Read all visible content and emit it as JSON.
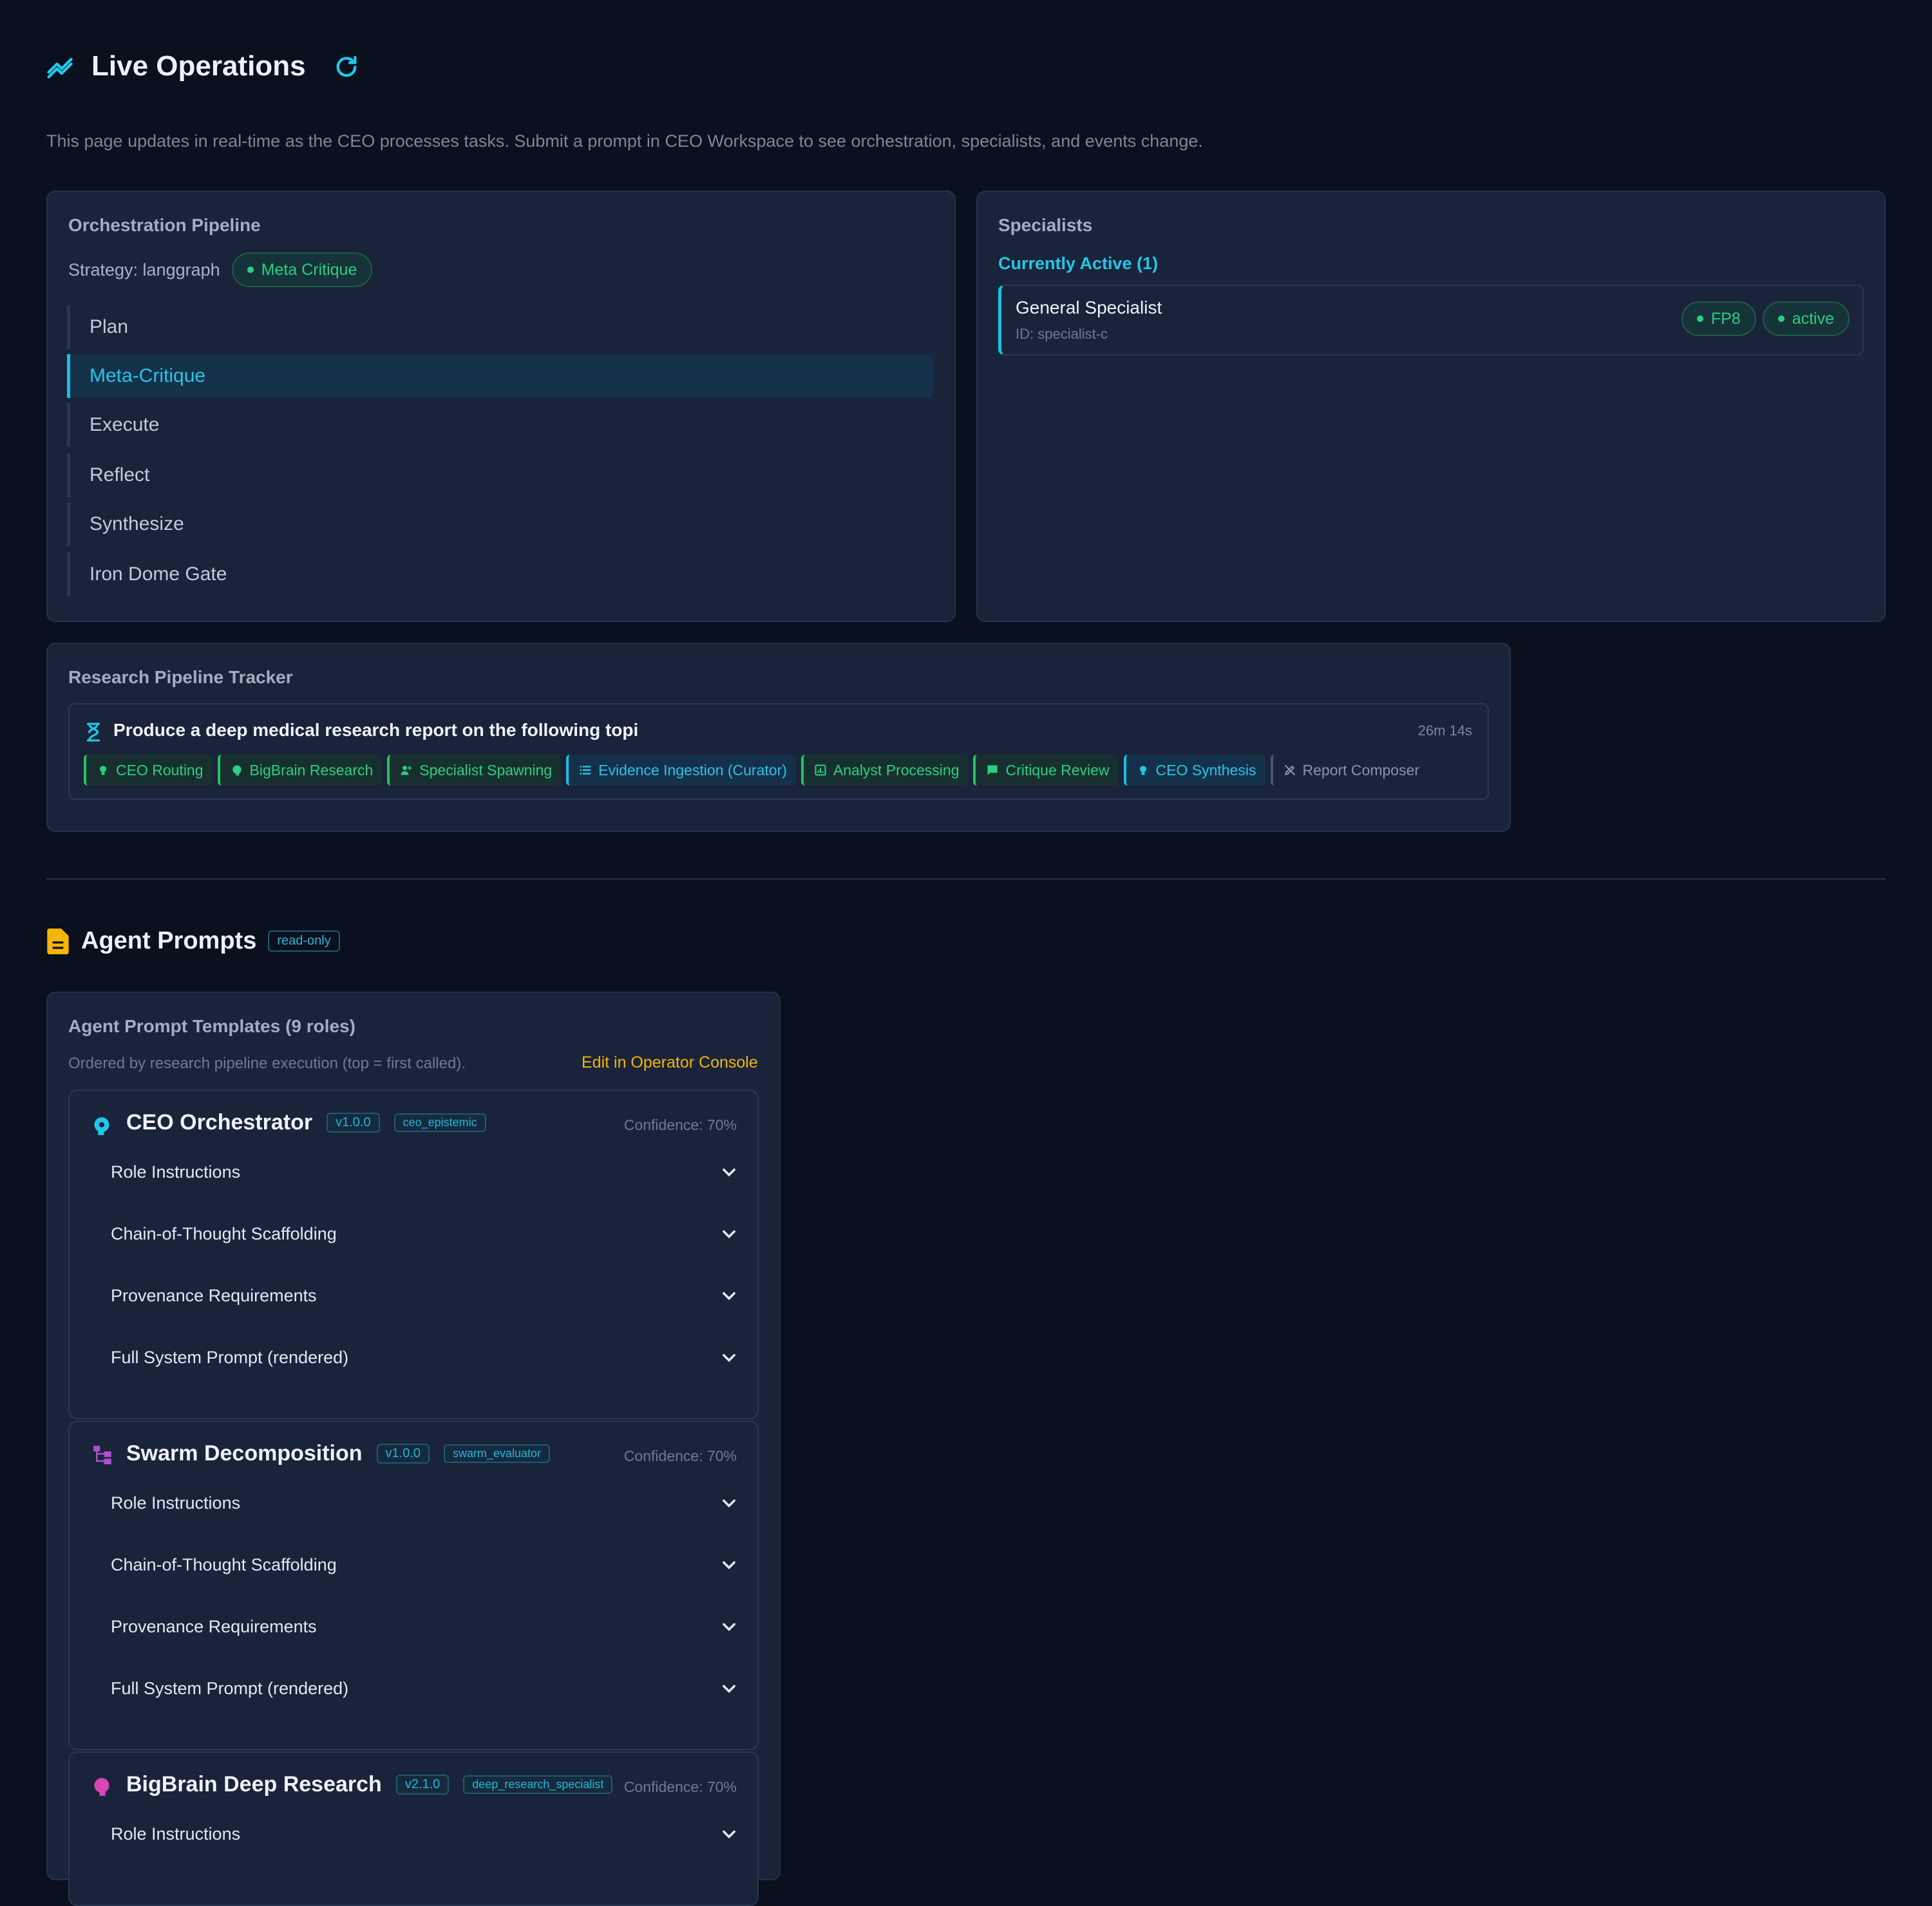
{
  "header": {
    "title": "Live Operations",
    "description": "This page updates in real-time as the CEO processes tasks. Submit a prompt in CEO Workspace to see orchestration, specialists, and events change."
  },
  "orchestration": {
    "title": "Orchestration Pipeline",
    "strategy_label": "Strategy: langgraph",
    "strategy_badge": "Meta Critique",
    "steps": [
      "Plan",
      "Meta-Critique",
      "Execute",
      "Reflect",
      "Synthesize",
      "Iron Dome Gate"
    ],
    "active_step": "Meta-Critique"
  },
  "specialists": {
    "title": "Specialists",
    "active_heading": "Currently Active (1)",
    "items": [
      {
        "name": "General Specialist",
        "id": "ID: specialist-c",
        "badges": [
          "FP8",
          "active"
        ]
      }
    ]
  },
  "tracker": {
    "title": "Research Pipeline Tracker",
    "task": "Produce a deep medical research report on the following topi",
    "elapsed": "26m 14s",
    "stages": [
      {
        "label": "CEO Routing",
        "state": "done",
        "icon": "lightbulb-icon"
      },
      {
        "label": "BigBrain Research",
        "state": "done",
        "icon": "brain-icon"
      },
      {
        "label": "Specialist Spawning",
        "state": "done",
        "icon": "person-add-icon"
      },
      {
        "label": "Evidence Ingestion (Curator)",
        "state": "active",
        "icon": "list-icon"
      },
      {
        "label": "Analyst Processing",
        "state": "done",
        "icon": "chart-icon"
      },
      {
        "label": "Critique Review",
        "state": "done",
        "icon": "comment-icon"
      },
      {
        "label": "CEO Synthesis",
        "state": "active",
        "icon": "lightbulb-icon"
      },
      {
        "label": "Report Composer",
        "state": "pending",
        "icon": "pen-icon"
      }
    ]
  },
  "agent_prompts": {
    "title": "Agent Prompts",
    "badge": "read-only",
    "panel_title": "Agent Prompt Templates (9 roles)",
    "subtitle": "Ordered by research pipeline execution (top = first called).",
    "edit_link": "Edit in Operator Console",
    "roles": [
      {
        "name": "CEO Orchestrator",
        "version": "v1.0.0",
        "key": "ceo_epistemic",
        "confidence": "Confidence: 70%",
        "icon": "brain-head-icon",
        "icon_color": "#22c7e8",
        "sections": [
          "Role Instructions",
          "Chain-of-Thought Scaffolding",
          "Provenance Requirements",
          "Full System Prompt (rendered)"
        ]
      },
      {
        "name": "Swarm Decomposition",
        "version": "v1.0.0",
        "key": "swarm_evaluator",
        "confidence": "Confidence: 70%",
        "icon": "hierarchy-icon",
        "icon_color": "#b04fcf",
        "sections": [
          "Role Instructions",
          "Chain-of-Thought Scaffolding",
          "Provenance Requirements",
          "Full System Prompt (rendered)"
        ]
      },
      {
        "name": "BigBrain Deep Research",
        "version": "v2.1.0",
        "key": "deep_research_specialist",
        "confidence": "Confidence: 70%",
        "icon": "brain-icon",
        "icon_color": "#d946b5",
        "sections": [
          "Role Instructions"
        ]
      }
    ]
  },
  "colors": {
    "accent": "#22c7e8",
    "success": "#2bd07f",
    "warning": "#f5b50a",
    "background": "#0a101d",
    "panel": "#19233a"
  }
}
